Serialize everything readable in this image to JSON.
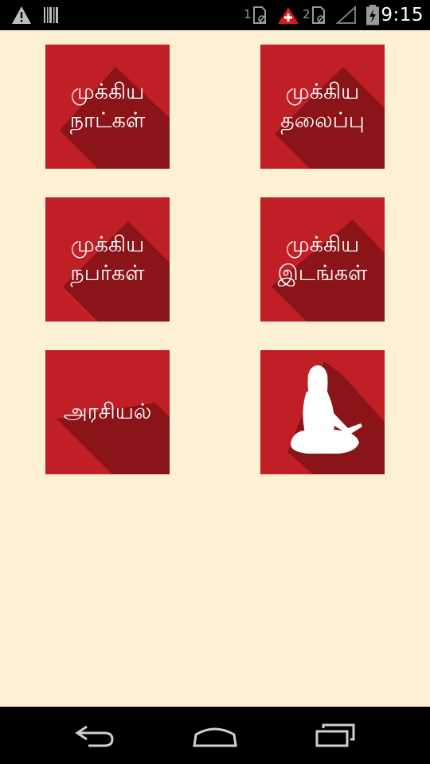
{
  "status_bar": {
    "time": "9:15",
    "sim1_label": "1",
    "sim2_label": "2",
    "icons": [
      "warning-icon",
      "barcode-icon",
      "sim-card-icon",
      "medical-alert-icon",
      "sim-card-icon",
      "no-signal-icon",
      "battery-charging-icon"
    ]
  },
  "tiles": [
    {
      "line1": "முக்கிய",
      "line2": "நாட்கள்"
    },
    {
      "line1": "முக்கிய",
      "line2": "தலைப்பு"
    },
    {
      "line1": "முக்கிய",
      "line2": "நபர்கள்"
    },
    {
      "line1": "முக்கிய",
      "line2": "இடங்கள்"
    },
    {
      "line1": "அரசியல்"
    },
    {
      "icon": "meditating-person-icon"
    }
  ],
  "nav_bar": {
    "icons": [
      "back-icon",
      "home-icon",
      "recent-apps-icon"
    ]
  },
  "colors": {
    "background": "#fdf0d3",
    "tile": "#bf1f25",
    "tile_shadow": "#8a1418"
  }
}
